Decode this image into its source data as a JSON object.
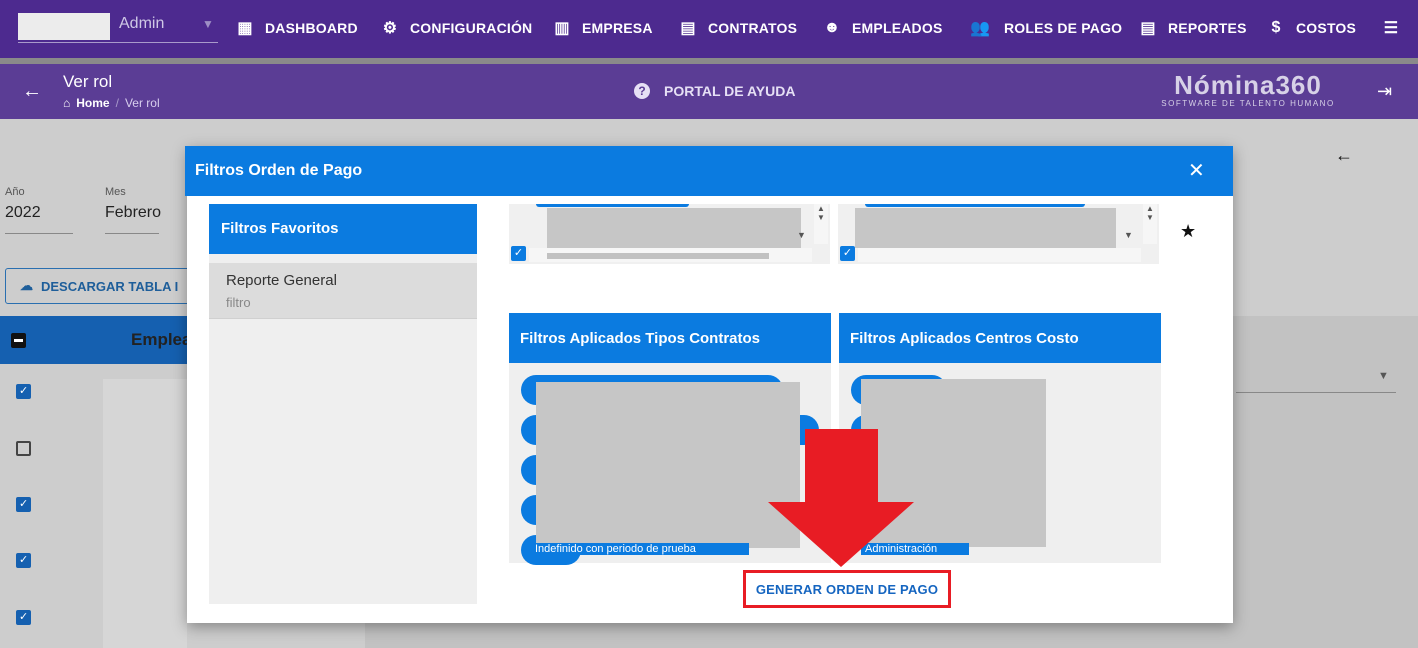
{
  "topnav": {
    "user_role": "Admin",
    "items": [
      {
        "label": "DASHBOARD",
        "icon": "dashboard-icon"
      },
      {
        "label": "CONFIGURACIÓN",
        "icon": "gear-icon"
      },
      {
        "label": "EMPRESA",
        "icon": "building-icon"
      },
      {
        "label": "CONTRATOS",
        "icon": "clipboard-icon"
      },
      {
        "label": "EMPLEADOS",
        "icon": "face-icon"
      },
      {
        "label": "ROLES DE PAGO",
        "icon": "people-icon"
      },
      {
        "label": "REPORTES",
        "icon": "report-icon"
      },
      {
        "label": "COSTOS",
        "icon": "invoice-icon"
      }
    ]
  },
  "subheader": {
    "title": "Ver rol",
    "breadcrumb_home": "Home",
    "breadcrumb_sep": "/",
    "breadcrumb_current": "Ver rol",
    "help_label": "PORTAL DE AYUDA",
    "brand_name": "Nómina360",
    "brand_tagline": "SOFTWARE DE TALENTO HUMANO"
  },
  "background": {
    "year_label": "Año",
    "year_value": "2022",
    "month_label": "Mes",
    "month_value": "Febrero",
    "download_button": "DESCARGAR TABLA I",
    "table_header": "Emplea",
    "row_checks": [
      true,
      false,
      true,
      true,
      true
    ]
  },
  "modal": {
    "title": "Filtros Orden de Pago",
    "favorites": {
      "heading": "Filtros Favoritos",
      "items": [
        {
          "title": "Reporte General",
          "subtitle": "filtro"
        }
      ]
    },
    "panel_contracts": {
      "heading": "Filtros Aplicados Tipos Contratos",
      "last_chip": "Indefinido con periodo de prueba"
    },
    "panel_costs": {
      "heading": "Filtros Aplicados Centros Costo",
      "last_chip": "Administración"
    },
    "generate_button": "GENERAR ORDEN DE PAGO"
  },
  "colors": {
    "nav_bg": "#4d2a8f",
    "subheader_bg": "#5b3d95",
    "accent": "#0b7be0",
    "highlight": "#e81c24"
  }
}
